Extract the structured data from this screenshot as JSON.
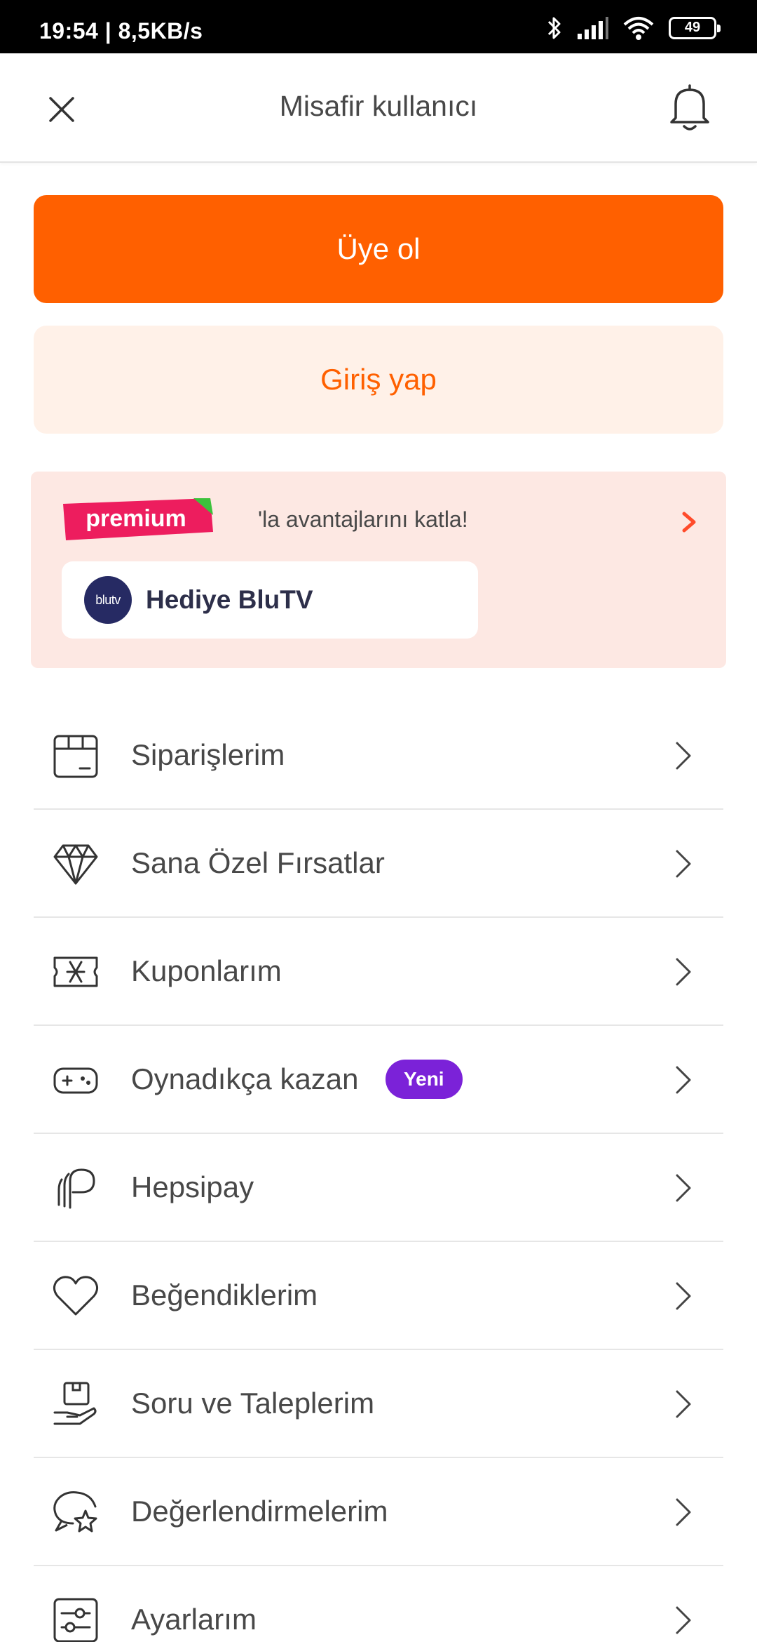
{
  "status_bar": {
    "time_speed": "19:54 | 8,5KB/s",
    "battery": "49"
  },
  "header": {
    "title": "Misafir kullanıcı"
  },
  "actions": {
    "signup_label": "Üye ol",
    "login_label": "Giriş yap"
  },
  "premium": {
    "logo_text": "premium",
    "tagline": "'la avantajlarını katla!",
    "gift_logo_text": "blutv",
    "gift_label": "Hediye BluTV"
  },
  "menu": {
    "items": [
      {
        "label": "Siparişlerim",
        "icon": "box-icon"
      },
      {
        "label": "Sana Özel Fırsatlar",
        "icon": "diamond-icon"
      },
      {
        "label": "Kuponlarım",
        "icon": "coupon-icon"
      },
      {
        "label": "Oynadıkça kazan",
        "icon": "gamepad-icon",
        "badge": "Yeni"
      },
      {
        "label": "Hepsipay",
        "icon": "hepsipay-icon"
      },
      {
        "label": "Beğendiklerim",
        "icon": "heart-icon"
      },
      {
        "label": "Soru ve Taleplerim",
        "icon": "hand-box-icon"
      },
      {
        "label": "Değerlendirmelerim",
        "icon": "chat-star-icon"
      },
      {
        "label": "Ayarlarım",
        "icon": "settings-sliders-icon"
      }
    ]
  },
  "colors": {
    "brand_orange": "#ff6000",
    "login_bg": "#fff1e8",
    "premium_bg": "#fde8e3",
    "badge_purple": "#7b22d8"
  }
}
